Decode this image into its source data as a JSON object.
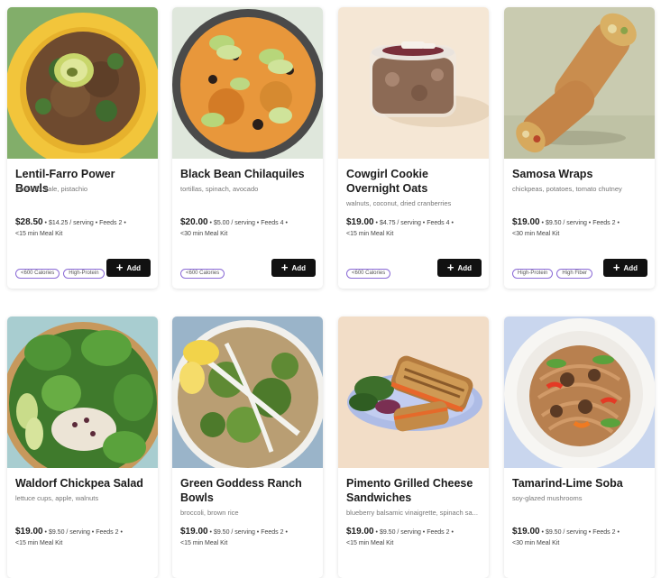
{
  "cards": [
    {
      "title": "Lentil-Farro Power Bowls",
      "desc": "avocado, kale, pistachio",
      "price": "$28.50",
      "details": "• $14.25 / serving • Feeds 2 •",
      "kit": "<15 min Meal Kit",
      "tags": [
        "<600 Calories",
        "High-Protein"
      ],
      "add": "Add",
      "image": "lentil-farro-bowl"
    },
    {
      "title": "Black Bean Chilaquiles",
      "desc": "tortillas, spinach, avocado",
      "price": "$20.00",
      "details": "• $5.00 / serving • Feeds 4 •",
      "kit": "<30 min Meal Kit",
      "tags": [
        "<600 Calories"
      ],
      "add": "Add",
      "image": "chilaquiles-pan"
    },
    {
      "title": "Cowgirl Cookie Overnight Oats",
      "desc": "walnuts, coconut, dried cranberries",
      "price": "$19.00",
      "details": "• $4.75 / serving • Feeds 4 •",
      "kit": "<15 min Meal Kit",
      "tags": [
        "<600 Calories"
      ],
      "add": "Add",
      "image": "overnight-oats-jar"
    },
    {
      "title": "Samosa Wraps",
      "desc": "chickpeas, potatoes, tomato chutney",
      "price": "$19.00",
      "details": "• $9.50 / serving • Feeds 2 •",
      "kit": "<30 min Meal Kit",
      "tags": [
        "High-Protein",
        "High Fiber"
      ],
      "add": "Add",
      "image": "samosa-wraps"
    },
    {
      "title": "Waldorf Chickpea Salad",
      "desc": "lettuce cups, apple, walnuts",
      "price": "$19.00",
      "details": "• $9.50 / serving • Feeds 2 •",
      "kit": "<15 min Meal Kit",
      "image": "waldorf-salad"
    },
    {
      "title": "Green Goddess Ranch Bowls",
      "desc": "broccoli, brown rice",
      "price": "$19.00",
      "details": "• $9.50 / serving • Feeds 2 •",
      "kit": "<15 min Meal Kit",
      "image": "green-goddess-bowl"
    },
    {
      "title": "Pimento Grilled Cheese Sandwiches",
      "desc": "blueberry balsamic vinaigrette, spinach sa...",
      "price": "$19.00",
      "details": "• $9.50 / serving • Feeds 2 •",
      "kit": "<15 min Meal Kit",
      "image": "grilled-cheese-plate"
    },
    {
      "title": "Tamarind-Lime Soba",
      "desc": "soy-glazed mushrooms",
      "price": "$19.00",
      "details": "• $9.50 / serving • Feeds 2 •",
      "kit": "<30 min Meal Kit",
      "image": "soba-noodles"
    }
  ],
  "colors": {
    "tag_border": "#8b6bd6",
    "add_button": "#111111"
  }
}
